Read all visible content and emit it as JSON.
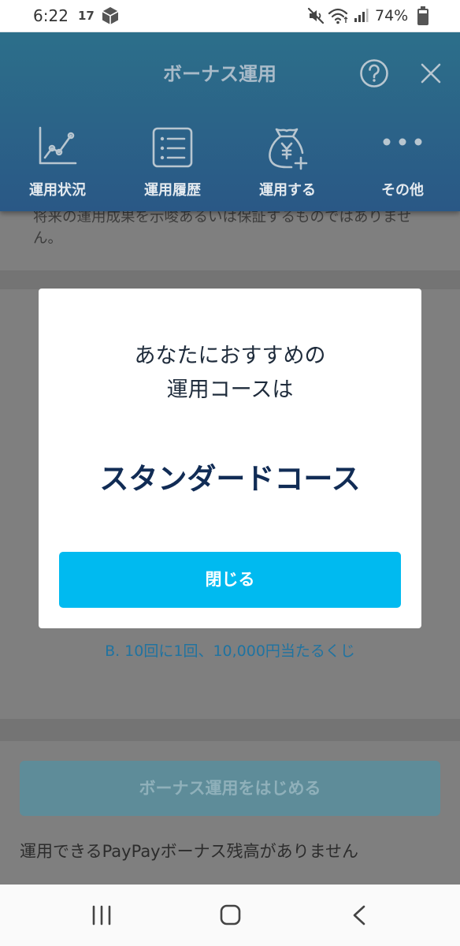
{
  "status_bar": {
    "time": "6:22",
    "notification_text": "17",
    "battery_text": "74%",
    "battery_level": 0.74,
    "icons": [
      "package-icon",
      "mute-icon",
      "wifi-icon",
      "signal-icon",
      "battery-icon"
    ]
  },
  "header": {
    "title": "ボーナス運用",
    "help_icon": "question-circle-icon",
    "close_icon": "close-icon",
    "tabs": [
      {
        "label": "運用状況",
        "icon": "line-chart-icon"
      },
      {
        "label": "運用履歴",
        "icon": "list-icon"
      },
      {
        "label": "運用する",
        "icon": "money-bag-plus-icon"
      },
      {
        "label": "その他",
        "icon": "more-dots-icon"
      }
    ]
  },
  "content": {
    "disclaimer_lines": [
      "将来の運用成果を示唆あるいは保証するものではありませ",
      "ん。"
    ],
    "lottery_option": "B. 10回に1回、10,000円当たるくじ",
    "start_button_label": "ボーナス運用をはじめる",
    "no_balance_message": "運用できるPayPayボーナス残高がありません"
  },
  "modal": {
    "lead_lines": [
      "あなたにおすすめの",
      "運用コースは"
    ],
    "recommended_course": "スタンダードコース",
    "close_button_label": "閉じる"
  },
  "nav_bar": {
    "icons": [
      "recent-apps-icon",
      "home-icon",
      "back-icon"
    ]
  },
  "colors": {
    "header_gradient_top": "#2c6f8a",
    "header_gradient_bottom": "#2a5886",
    "primary_button": "#00baf0",
    "course_name_text": "#112c55",
    "link_text": "#1f73a1",
    "disabled_button": "#5e8c99"
  }
}
